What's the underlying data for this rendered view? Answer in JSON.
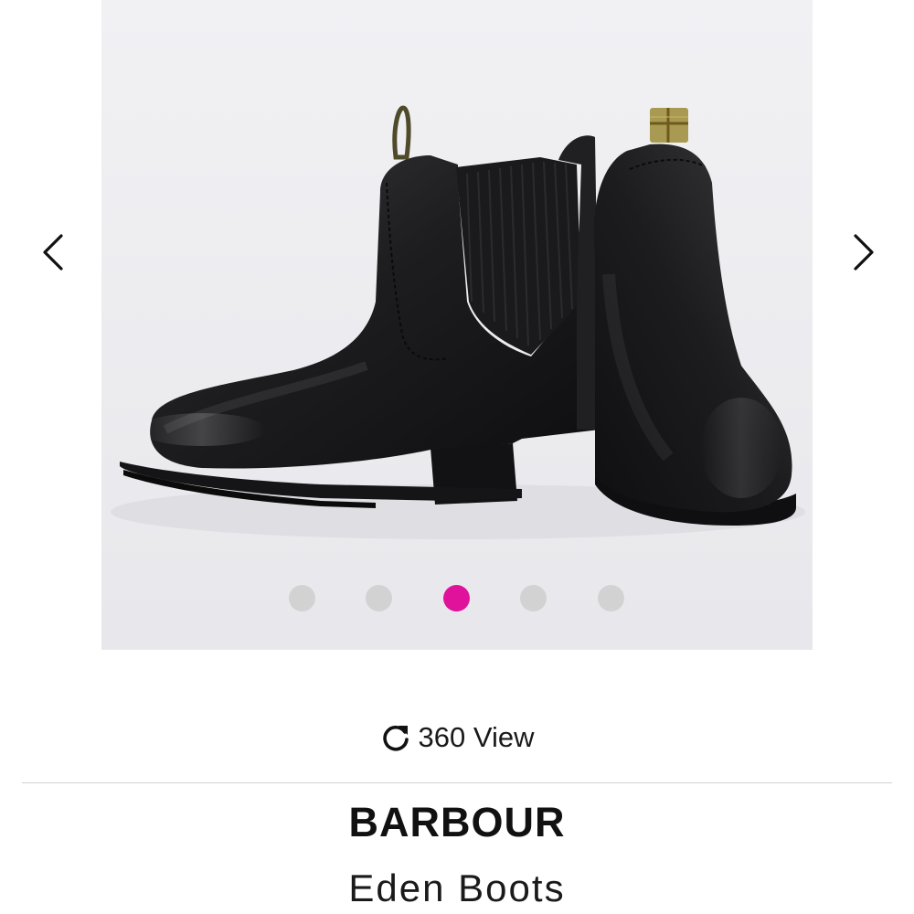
{
  "gallery": {
    "image_alt": "Eden Boots",
    "prev_icon": "chevron-left-icon",
    "next_icon": "chevron-right-icon",
    "slide_count": 5,
    "active_slide": 3,
    "colors": {
      "background": "#f4f4f6",
      "dot": "#d2d2d2",
      "dot_active": "#e0119a"
    }
  },
  "view360": {
    "icon": "refresh-icon",
    "label": "360 View"
  },
  "product": {
    "brand": "BARBOUR",
    "name": "Eden Boots"
  }
}
